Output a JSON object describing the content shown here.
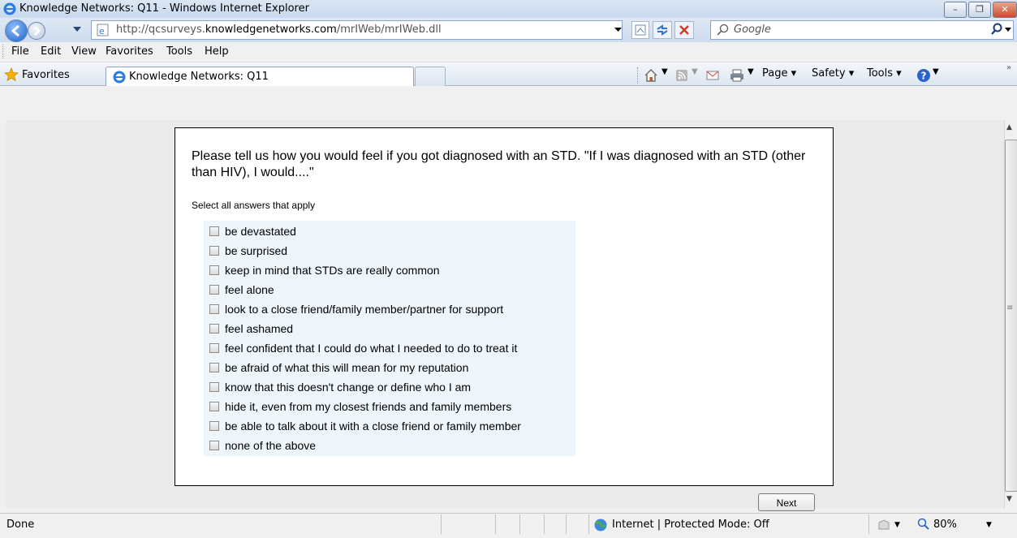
{
  "window": {
    "title": "Knowledge Networks: Q11 - Windows Internet Explorer",
    "controls": {
      "minimize": "–",
      "maximize": "❐",
      "close": "✕"
    }
  },
  "address_bar": {
    "url_prefix": "http://qcsurveys.",
    "url_domain": "knowledgenetworks.com",
    "url_path": "/mrIWeb/mrIWeb.dll",
    "search_placeholder": "Google"
  },
  "menu": {
    "file": "File",
    "edit": "Edit",
    "view": "View",
    "favorites": "Favorites",
    "tools": "Tools",
    "help": "Help"
  },
  "favorites_bar": {
    "favorites_label": "Favorites",
    "tab_title": "Knowledge Networks: Q11"
  },
  "command_bar": {
    "page": "Page ▾",
    "safety": "Safety ▾",
    "tools": "Tools ▾"
  },
  "survey": {
    "question": "Please tell us how you would feel if you got diagnosed with an STD. \"If I was diagnosed with an STD (other than HIV), I would....\"",
    "instruction": "Select all answers that apply",
    "options": [
      "be devastated",
      "be surprised",
      "keep in mind that STDs are really common",
      "feel alone",
      "look to a close friend/family member/partner for support",
      "feel ashamed",
      "feel confident that I could do what I needed to do to treat it",
      "be afraid of what this will mean for my reputation",
      "know that this doesn't change or define who I am",
      "hide it, even from my closest friends and family members",
      "be able to talk about it with a close friend or family member",
      "none of the above"
    ],
    "next_label": "Next"
  },
  "status_bar": {
    "status": "Done",
    "zone": "Internet | Protected Mode: Off",
    "zoom": "80%"
  }
}
